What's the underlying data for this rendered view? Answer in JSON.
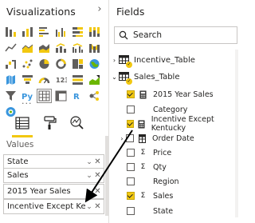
{
  "visualizations": {
    "title": "Visualizations",
    "collapse_glyph": "›",
    "more_glyph": "···",
    "values_label": "Values",
    "wells": [
      {
        "label": "State"
      },
      {
        "label": "Sales"
      },
      {
        "label": "2015 Year Sales"
      },
      {
        "label": "Incentive Except Kentucky"
      }
    ],
    "well_chevron": "⌄",
    "well_remove": "✕"
  },
  "fields": {
    "title": "Fields",
    "search_placeholder": "Search",
    "tables": [
      {
        "name": "Incentive_Table",
        "expanded": false
      },
      {
        "name": "Sales_Table",
        "expanded": true
      }
    ],
    "items": [
      {
        "label": "2015 Year Sales",
        "checked": true,
        "icon": "calculator-icon"
      },
      {
        "label": "Category",
        "checked": false,
        "icon": "none"
      },
      {
        "label": "Incentive Except Kentucky",
        "checked": true,
        "icon": "calculator-icon"
      },
      {
        "label": "Order Date",
        "checked": false,
        "icon": "hierarchy-icon"
      },
      {
        "label": "Price",
        "checked": false,
        "icon": "sigma-icon"
      },
      {
        "label": "Qty",
        "checked": false,
        "icon": "sigma-icon"
      },
      {
        "label": "Region",
        "checked": false,
        "icon": "none"
      },
      {
        "label": "Sales",
        "checked": true,
        "icon": "sigma-icon"
      },
      {
        "label": "State",
        "checked": false,
        "icon": "none"
      }
    ],
    "sigma_glyph": "Σ",
    "chev_right": "›",
    "chev_down": "⌄",
    "badge_glyph": "✓"
  },
  "colors": {
    "accent": "#f2c811",
    "border": "#c8c6c4",
    "text": "#252423",
    "arrow": "#000000"
  }
}
